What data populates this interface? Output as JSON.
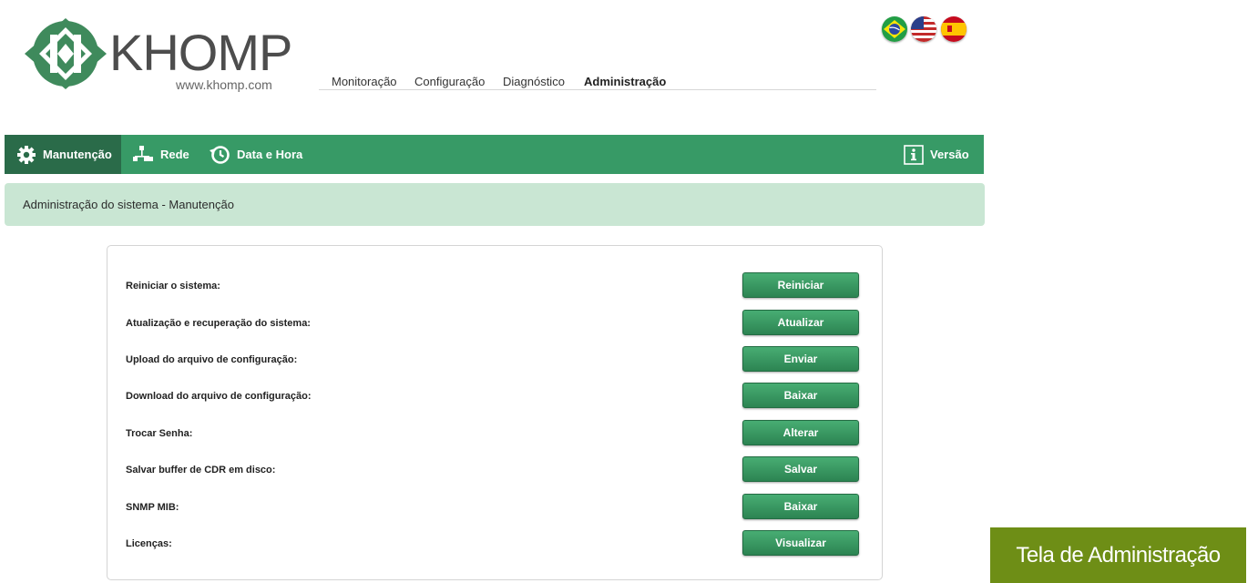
{
  "header": {
    "brand": "KHOMP",
    "url": "www.khomp.com"
  },
  "top_nav": [
    {
      "label": "Monitoração",
      "active": false
    },
    {
      "label": "Configuração",
      "active": false
    },
    {
      "label": "Diagnóstico",
      "active": false
    },
    {
      "label": "Administração",
      "active": true
    }
  ],
  "languages": [
    {
      "icon": "flag-brazil-icon"
    },
    {
      "icon": "flag-usa-icon"
    },
    {
      "icon": "flag-spain-icon"
    }
  ],
  "menu": {
    "items": [
      {
        "label": "Manutenção",
        "icon": "gear-icon",
        "active": true
      },
      {
        "label": "Rede",
        "icon": "network-icon",
        "active": false
      },
      {
        "label": "Data e Hora",
        "icon": "clock-history-icon",
        "active": false
      }
    ],
    "right": {
      "label": "Versão",
      "icon": "info-icon"
    }
  },
  "section": {
    "title": "Administração do sistema - Manutenção"
  },
  "maintenance": [
    {
      "label": "Reiniciar o sistema:",
      "button": "Reiniciar"
    },
    {
      "label": "Atualização e recuperação do sistema:",
      "button": "Atualizar"
    },
    {
      "label": "Upload do arquivo de configuração:",
      "button": "Enviar"
    },
    {
      "label": "Download do arquivo de configuração:",
      "button": "Baixar"
    },
    {
      "label": "Trocar Senha:",
      "button": "Alterar"
    },
    {
      "label": "Salvar buffer de CDR em disco:",
      "button": "Salvar"
    },
    {
      "label": "SNMP MIB:",
      "button": "Baixar"
    },
    {
      "label": "Licenças:",
      "button": "Visualizar"
    }
  ],
  "caption": "Tela de Administração",
  "colors": {
    "menu_bar": "#379a66",
    "menu_active": "#2a6b49",
    "section_bg": "#c9e6d3",
    "button": "#2f8a56",
    "caption_bg": "#6e8e16"
  }
}
